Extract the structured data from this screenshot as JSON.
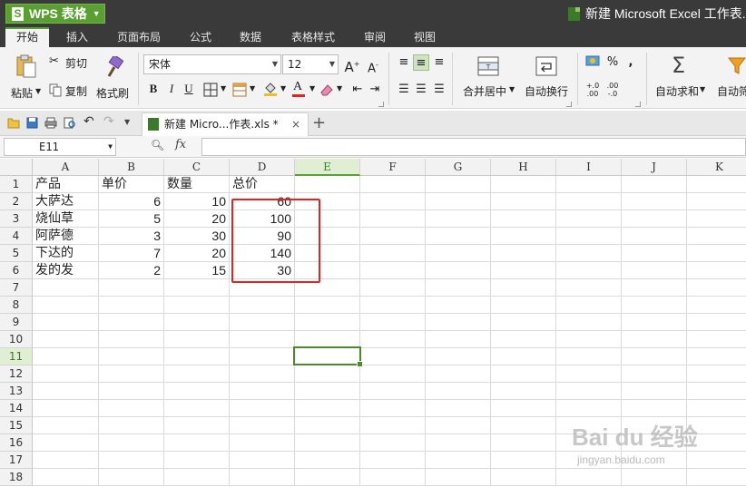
{
  "titlebar": {
    "app_name": "WPS 表格",
    "document_title": "新建 Microsoft Excel 工作表.xls"
  },
  "tabs": [
    "开始",
    "插入",
    "页面布局",
    "公式",
    "数据",
    "表格样式",
    "审阅",
    "视图"
  ],
  "ribbon": {
    "paste": "粘贴",
    "cut": "剪切",
    "copy": "复制",
    "format_painter": "格式刷",
    "font_name": "宋体",
    "font_size": "12",
    "bold": "B",
    "italic": "I",
    "underline": "U",
    "merge_center": "合并居中",
    "wrap_text": "自动换行",
    "percent": "%",
    "comma": ",",
    "autosum": "自动求和",
    "autofilter_partial": "自动筛"
  },
  "doc_tab": {
    "label": "新建 Micro...作表.xls *",
    "close": "×",
    "new_tab": "+"
  },
  "formula_bar": {
    "name_box": "E11",
    "fx": "fx",
    "formula": ""
  },
  "sheet": {
    "columns": [
      "A",
      "B",
      "C",
      "D",
      "E",
      "F",
      "G",
      "H",
      "I",
      "J",
      "K"
    ],
    "rows": [
      "1",
      "2",
      "3",
      "4",
      "5",
      "6",
      "7",
      "8",
      "9",
      "10",
      "11",
      "12",
      "13",
      "14",
      "15",
      "16",
      "17",
      "18"
    ],
    "selected_column": "E",
    "selected_row": "11",
    "header": [
      "产品",
      "单价",
      "数量",
      "总价"
    ],
    "data": [
      [
        "大萨达",
        "6",
        "10",
        "60"
      ],
      [
        "烧仙草",
        "5",
        "20",
        "100"
      ],
      [
        "阿萨德",
        "3",
        "30",
        "90"
      ],
      [
        "下达的",
        "7",
        "20",
        "140"
      ],
      [
        "发的发",
        "2",
        "15",
        "30"
      ]
    ]
  },
  "colors": {
    "accent_green": "#5a9f32",
    "highlight_red": "#e02424",
    "titlebar_dark": "#3a3a3a"
  },
  "watermark": {
    "main": "Bai du 经验",
    "sub": "jingyan.baidu.com"
  }
}
